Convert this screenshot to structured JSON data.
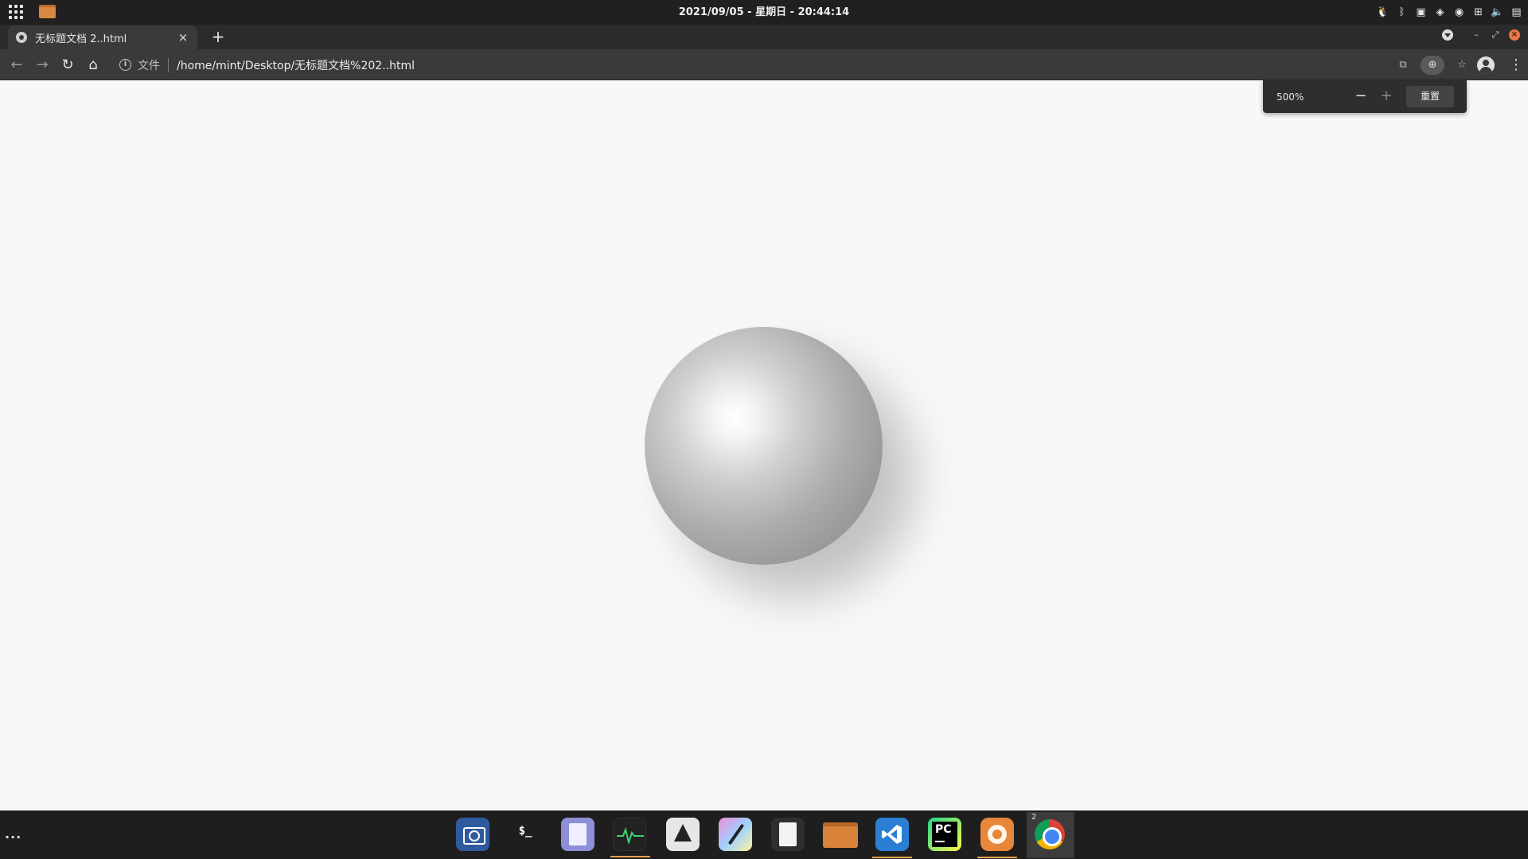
{
  "system_bar": {
    "clock": "2021/09/05 - 星期日 - 20:44:14"
  },
  "browser": {
    "tab": {
      "title": "无标题文档 2..html",
      "close_glyph": "×"
    },
    "new_tab_glyph": "+",
    "address": {
      "scheme_label": "文件",
      "url": "/home/mint/Desktop/无标题文档%202..html"
    },
    "zoom_popup": {
      "level": "500%",
      "minus_glyph": "−",
      "plus_glyph": "+",
      "reset_label": "重置"
    }
  },
  "dock": {
    "more_glyph": "...",
    "chrome_window_count": "2",
    "terminal_glyph": "$_",
    "pycharm_glyph": "PC",
    "items": [
      "camera-icon",
      "terminal-icon",
      "text-editor-icon",
      "system-monitor-icon",
      "inkscape-icon",
      "paint-icon",
      "file-icon",
      "folder-icon",
      "vscode-icon",
      "pycharm-icon",
      "firefox-icon",
      "chrome-icon"
    ]
  },
  "colors": {
    "page_background": "#f8f8f8",
    "dock_indicator": "#e8a04e",
    "sphere_shade": "#8c8c8c"
  }
}
